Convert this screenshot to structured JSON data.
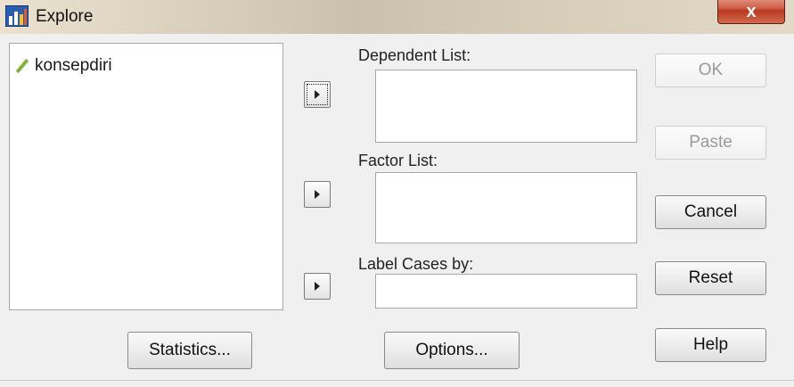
{
  "window": {
    "title": "Explore",
    "close_label": "x"
  },
  "source_list": {
    "items": [
      {
        "label": "konsepdiri",
        "icon": "pencil-icon (scale variable)"
      }
    ]
  },
  "fields": {
    "dependent_list_label": "Dependent List:",
    "factor_list_label": "Factor List:",
    "label_cases_label": "Label Cases by:"
  },
  "buttons": {
    "ok": "OK",
    "paste": "Paste",
    "cancel": "Cancel",
    "reset": "Reset",
    "help": "Help",
    "statistics": "Statistics...",
    "options": "Options..."
  },
  "colors": {
    "close_button": "#c8492f",
    "scale_icon": "#7db33a"
  }
}
